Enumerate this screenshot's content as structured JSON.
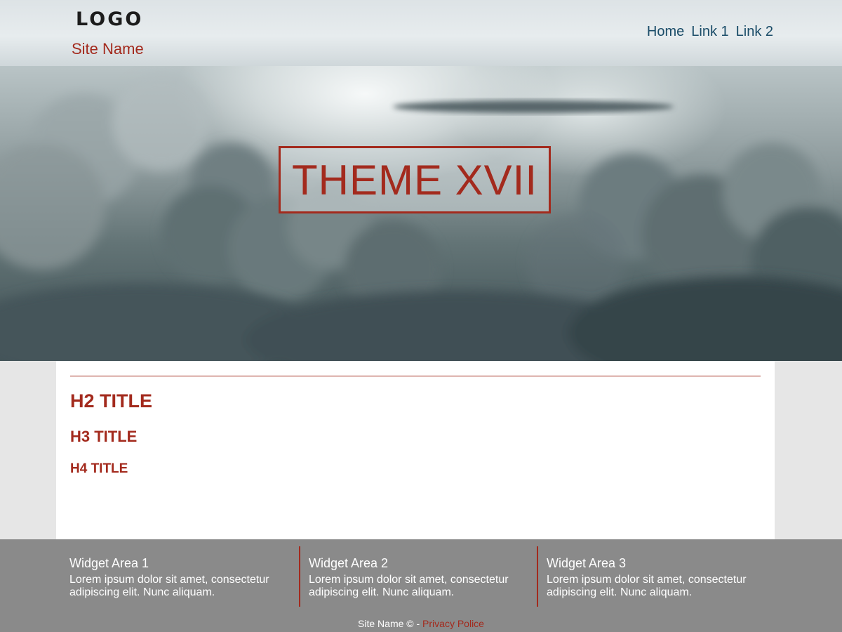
{
  "header": {
    "logo": "LOGO",
    "site_name": "Site Name",
    "nav": [
      {
        "label": "Home"
      },
      {
        "label": "Link 1"
      },
      {
        "label": "Link 2"
      }
    ]
  },
  "hero": {
    "title": "THEME XVII"
  },
  "main": {
    "h2": "H2 TITLE",
    "h3": "H3 TITLE",
    "h4": "H4 TITLE"
  },
  "footer": {
    "widgets": [
      {
        "title": "Widget Area 1",
        "text": "Lorem ipsum dolor sit amet, consectetur adipiscing elit. Nunc aliquam."
      },
      {
        "title": "Widget Area 2",
        "text": "Lorem ipsum dolor sit amet, consectetur adipiscing elit. Nunc aliquam."
      },
      {
        "title": "Widget Area 3",
        "text": "Lorem ipsum dolor sit amet, consectetur adipiscing elit. Nunc aliquam."
      }
    ],
    "copyright_prefix": "Site Name © - ",
    "privacy_link": "Privacy Police"
  },
  "colors": {
    "accent": "#a32a1d",
    "nav_link": "#1a4c68",
    "footer_bg": "#8a8a8a",
    "page_bg": "#e6e6e6"
  }
}
